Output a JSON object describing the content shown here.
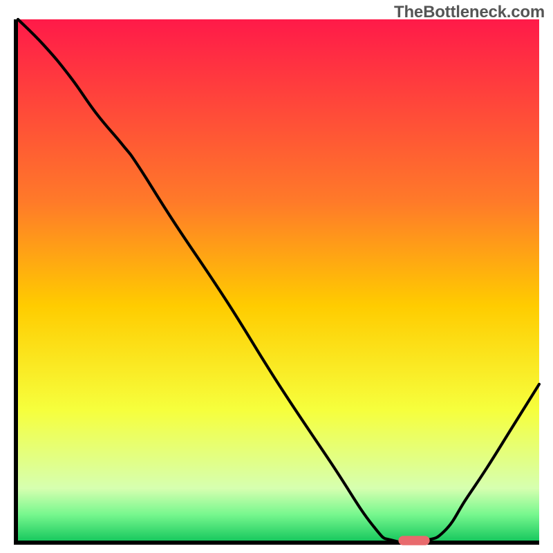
{
  "watermark": "TheBottleneck.com",
  "chart_data": {
    "type": "line",
    "title": "",
    "xlabel": "",
    "ylabel": "",
    "xlim": [
      0,
      100
    ],
    "ylim": [
      0,
      100
    ],
    "x": [
      0,
      5,
      10,
      15,
      20,
      23,
      30,
      40,
      50,
      60,
      68,
      72,
      78,
      82,
      86,
      90,
      95,
      100
    ],
    "y": [
      100,
      95,
      89,
      82,
      76,
      72,
      61,
      46,
      30,
      15,
      3,
      0,
      0,
      2,
      8,
      14,
      22,
      30
    ],
    "annotations": [
      {
        "type": "marker",
        "x": 76,
        "y": 0,
        "width_pct": 6,
        "color": "#e86a6d"
      }
    ],
    "background": {
      "type": "vertical-gradient",
      "stops": [
        {
          "pct": 0,
          "color": "#ff1a49"
        },
        {
          "pct": 35,
          "color": "#ff7a29"
        },
        {
          "pct": 55,
          "color": "#ffcc00"
        },
        {
          "pct": 75,
          "color": "#f6ff3d"
        },
        {
          "pct": 90,
          "color": "#d6ffb0"
        },
        {
          "pct": 95,
          "color": "#77f78e"
        },
        {
          "pct": 100,
          "color": "#19c95f"
        }
      ]
    }
  }
}
